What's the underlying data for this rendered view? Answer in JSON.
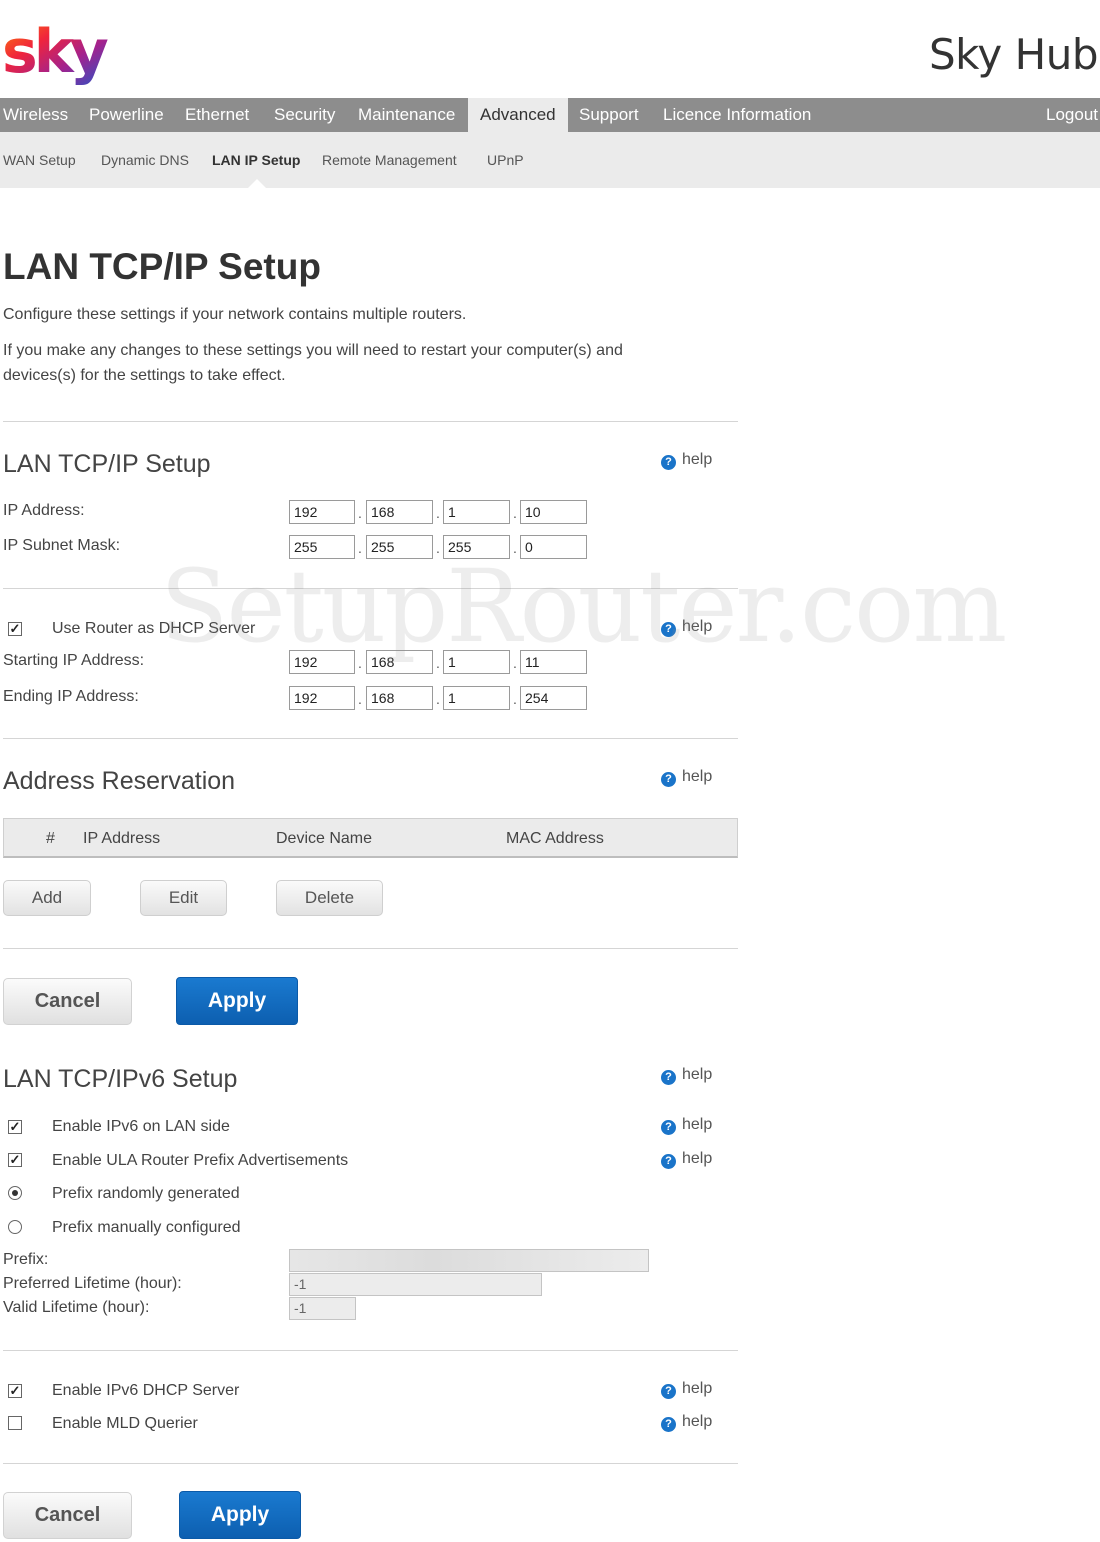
{
  "header": {
    "logo_text": "sky",
    "title": "Sky Hub"
  },
  "mainnav": {
    "items": [
      "Wireless",
      "Powerline",
      "Ethernet",
      "Security",
      "Maintenance",
      "Advanced",
      "Support",
      "Licence Information"
    ],
    "active": "Advanced",
    "logout": "Logout"
  },
  "subnav": {
    "items": [
      "WAN Setup",
      "Dynamic DNS",
      "LAN IP Setup",
      "Remote Management",
      "UPnP"
    ],
    "active": "LAN IP Setup"
  },
  "page": {
    "title": "LAN TCP/IP Setup",
    "intro1": "Configure these settings if your network contains multiple routers.",
    "intro2_line1": "If you make any changes to these settings you will need to restart your computer(s) and",
    "intro2_line2": "devices(s) for the settings to take effect."
  },
  "help_label": "help",
  "lan_setup": {
    "title": "LAN TCP/IP Setup",
    "ip_label": "IP Address:",
    "ip": [
      "192",
      "168",
      "1",
      "10"
    ],
    "mask_label": "IP Subnet Mask:",
    "mask": [
      "255",
      "255",
      "255",
      "0"
    ]
  },
  "dhcp": {
    "use_dhcp_label": "Use Router as DHCP Server",
    "use_dhcp_checked": true,
    "start_label": "Starting IP Address:",
    "start": [
      "192",
      "168",
      "1",
      "11"
    ],
    "end_label": "Ending IP Address:",
    "end": [
      "192",
      "168",
      "1",
      "254"
    ]
  },
  "reservation": {
    "title": "Address Reservation",
    "columns": [
      "#",
      "IP Address",
      "Device Name",
      "MAC Address"
    ],
    "rows": [],
    "add": "Add",
    "edit": "Edit",
    "delete": "Delete"
  },
  "buttons": {
    "cancel": "Cancel",
    "apply": "Apply"
  },
  "ipv6": {
    "title": "LAN TCP/IPv6 Setup",
    "enable_ipv6_label": "Enable IPv6 on LAN side",
    "enable_ipv6_checked": true,
    "enable_ula_label": "Enable ULA Router Prefix Advertisements",
    "enable_ula_checked": true,
    "prefix_random_label": "Prefix randomly generated",
    "prefix_random_selected": true,
    "prefix_manual_label": "Prefix manually configured",
    "prefix_label": "Prefix:",
    "prefix_value": "",
    "preferred_label": "Preferred Lifetime (hour):",
    "preferred_value": "-1",
    "valid_label": "Valid Lifetime (hour):",
    "valid_value": "-1",
    "dhcp6_label": "Enable IPv6 DHCP Server",
    "dhcp6_checked": true,
    "mld_label": "Enable MLD Querier",
    "mld_checked": false
  },
  "watermark": "SetupRouter.com"
}
